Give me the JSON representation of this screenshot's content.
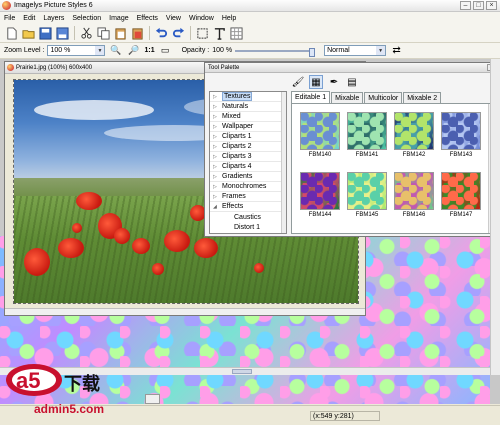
{
  "app": {
    "title": "Imagelys Picture Styles 6"
  },
  "menu": [
    "File",
    "Edit",
    "Layers",
    "Selection",
    "Image",
    "Effects",
    "View",
    "Window",
    "Help"
  ],
  "toolbar": {
    "tools": [
      "new-icon",
      "open-icon",
      "save-icon",
      "save-as-icon",
      "cut-icon",
      "copy-icon",
      "paste-icon",
      "paste-special-icon",
      "undo-icon",
      "redo-icon",
      "select-icon",
      "text-icon",
      "grid-icon"
    ]
  },
  "zoom": {
    "label": "Zoom Level :",
    "value": "100 %",
    "ratio_label": "1:1"
  },
  "opacity": {
    "label": "Opacity :",
    "value": "100 %",
    "level": 1.0
  },
  "blend_mode": {
    "value": "Normal"
  },
  "document": {
    "title": "Prairie1.jpg (100%) 600x400"
  },
  "palette": {
    "title": "Tool Palette",
    "categories": [
      "Textures",
      "Naturals",
      "Mixed",
      "Wallpaper",
      "Cliparts 1",
      "Cliparts 2",
      "Cliparts 3",
      "Cliparts 4",
      "Gradients",
      "Monochromes",
      "Frames"
    ],
    "effects_group": "Effects",
    "effects_items": [
      "Caustics",
      "Distort 1"
    ],
    "tabs": [
      "Editable 1",
      "Mixable",
      "Multicolor",
      "Mixable 2"
    ],
    "thumbnails": [
      {
        "name": "FBM140",
        "colors": [
          "#6bd3d4",
          "#b4e07a",
          "#6a8fd2"
        ]
      },
      {
        "name": "FBM141",
        "colors": [
          "#4ec8a8",
          "#2e6f6a",
          "#9fe4b0"
        ]
      },
      {
        "name": "FBM142",
        "colors": [
          "#1b2a6a",
          "#48a0a8",
          "#b2e46a"
        ]
      },
      {
        "name": "FBM143",
        "colors": [
          "#6e87d6",
          "#b5c7f2",
          "#4b5fb0"
        ]
      },
      {
        "name": "FBM144",
        "colors": [
          "#1f7a3a",
          "#d24a6a",
          "#6a2ab0"
        ]
      },
      {
        "name": "FBM145",
        "colors": [
          "#a8e86a",
          "#e8f08a",
          "#5ad0a8"
        ]
      },
      {
        "name": "FBM146",
        "colors": [
          "#6ad08a",
          "#c05ab0",
          "#e8c06a"
        ]
      },
      {
        "name": "FBM147",
        "colors": [
          "#c81a10",
          "#3a8a2a",
          "#ff6a4a"
        ]
      }
    ]
  },
  "status": {
    "coords": "(x:549 y:281)"
  },
  "watermark": {
    "cn": "下载",
    "url": "admin5.com"
  }
}
